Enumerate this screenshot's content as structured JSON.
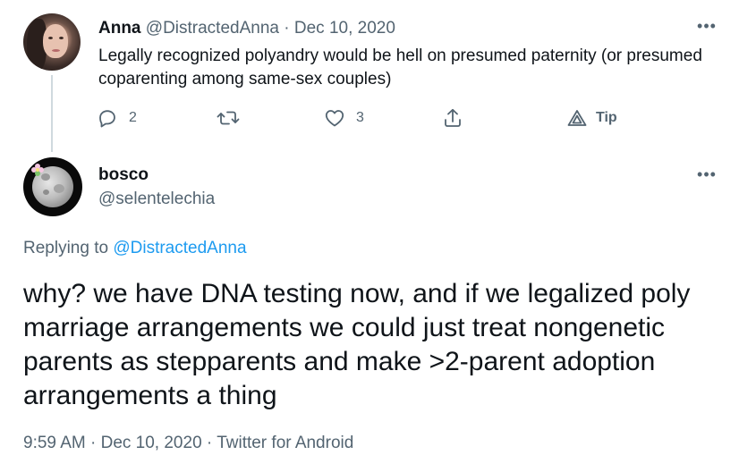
{
  "parent_tweet": {
    "display_name": "Anna",
    "handle": "@DistractedAnna",
    "separator": "·",
    "date": "Dec 10, 2020",
    "text": "Legally recognized polyandry would be hell on presumed paternity (or presumed coparenting among same-sex couples)",
    "reply_count": "2",
    "retweet_count": "",
    "like_count": "3",
    "tip_label": "Tip",
    "more_label": "•••"
  },
  "main_tweet": {
    "display_name": "bosco",
    "handle": "@selentelechia",
    "replying_to_prefix": "Replying to ",
    "replying_to_handle": "@DistractedAnna",
    "text": "why? we have DNA testing now, and if we legalized poly marriage arrangements we could just treat nongenetic parents as stepparents and make >2-parent adoption arrangements a thing",
    "time": "9:59 AM",
    "separator": "·",
    "date": "Dec 10, 2020",
    "source": "Twitter for Android",
    "more_label": "•••"
  },
  "colors": {
    "text_primary": "#0f1419",
    "text_secondary": "#536471",
    "link": "#1d9bf0",
    "thread_line": "#cfd9de"
  },
  "icons": {
    "reply": "reply-icon",
    "retweet": "retweet-icon",
    "like": "like-icon",
    "share": "share-icon",
    "tip": "tip-icon",
    "more": "more-icon"
  }
}
